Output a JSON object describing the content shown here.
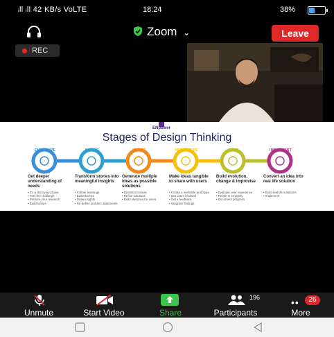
{
  "status_bar": {
    "network": "ᵢll ᵢll 42 KB/s VoLTE",
    "time": "18:24",
    "battery": "38%",
    "battery_level": 0.38
  },
  "top_bar": {
    "title": "Zoom",
    "leave_label": "Leave",
    "audio_icon": "headphones-icon",
    "security_icon": "shield-check-icon"
  },
  "recording": {
    "label": "REC"
  },
  "slide": {
    "logo": "ENpower",
    "title": "Stages of Design Thinking",
    "stages": [
      {
        "label": "EMPATHIZE",
        "color": "#3a8fd8",
        "heading": "Get deeper understanding of needs",
        "bullets": [
          "It's a discovery phase",
          "Feel the challenge",
          "Prepare your research",
          "Build stories"
        ]
      },
      {
        "label": "DEFINE",
        "color": "#2f9ed0",
        "heading": "Transform stories into meaningful insights",
        "bullets": [
          "Collate learnings",
          "Build themes",
          "Draw insights",
          "Re-define problem statements"
        ]
      },
      {
        "label": "IDEATE",
        "color": "#f08a1c",
        "heading": "Generate multiple ideas as possible solutions",
        "bullets": [
          "Brainstorm ideas",
          "Refine solutions",
          "Build sketches for users"
        ]
      },
      {
        "label": "PROTOTYPE",
        "color": "#f4c20d",
        "heading": "Make ideas tangible to share with users",
        "bullets": [
          "Create a workable prototype",
          "Get users involved",
          "Get a feedback",
          "Integrate findings"
        ]
      },
      {
        "label": "TEST",
        "color": "#b9c22a",
        "heading": "Build evolution, change & improvise",
        "bullets": [
          "Evaluate user experience",
          "Relate to empathy",
          "Document progress"
        ]
      },
      {
        "label": "IMPLEMENT",
        "color": "#b0338a",
        "heading": "Convert an idea into real life solution",
        "bullets": [
          "Build real life solution/s",
          "Implement"
        ]
      }
    ]
  },
  "bottom_bar": {
    "unmute": "Unmute",
    "start_video": "Start Video",
    "share": "Share",
    "participants": "Participants",
    "participants_count": "196",
    "more": "More",
    "more_badge": "26"
  }
}
